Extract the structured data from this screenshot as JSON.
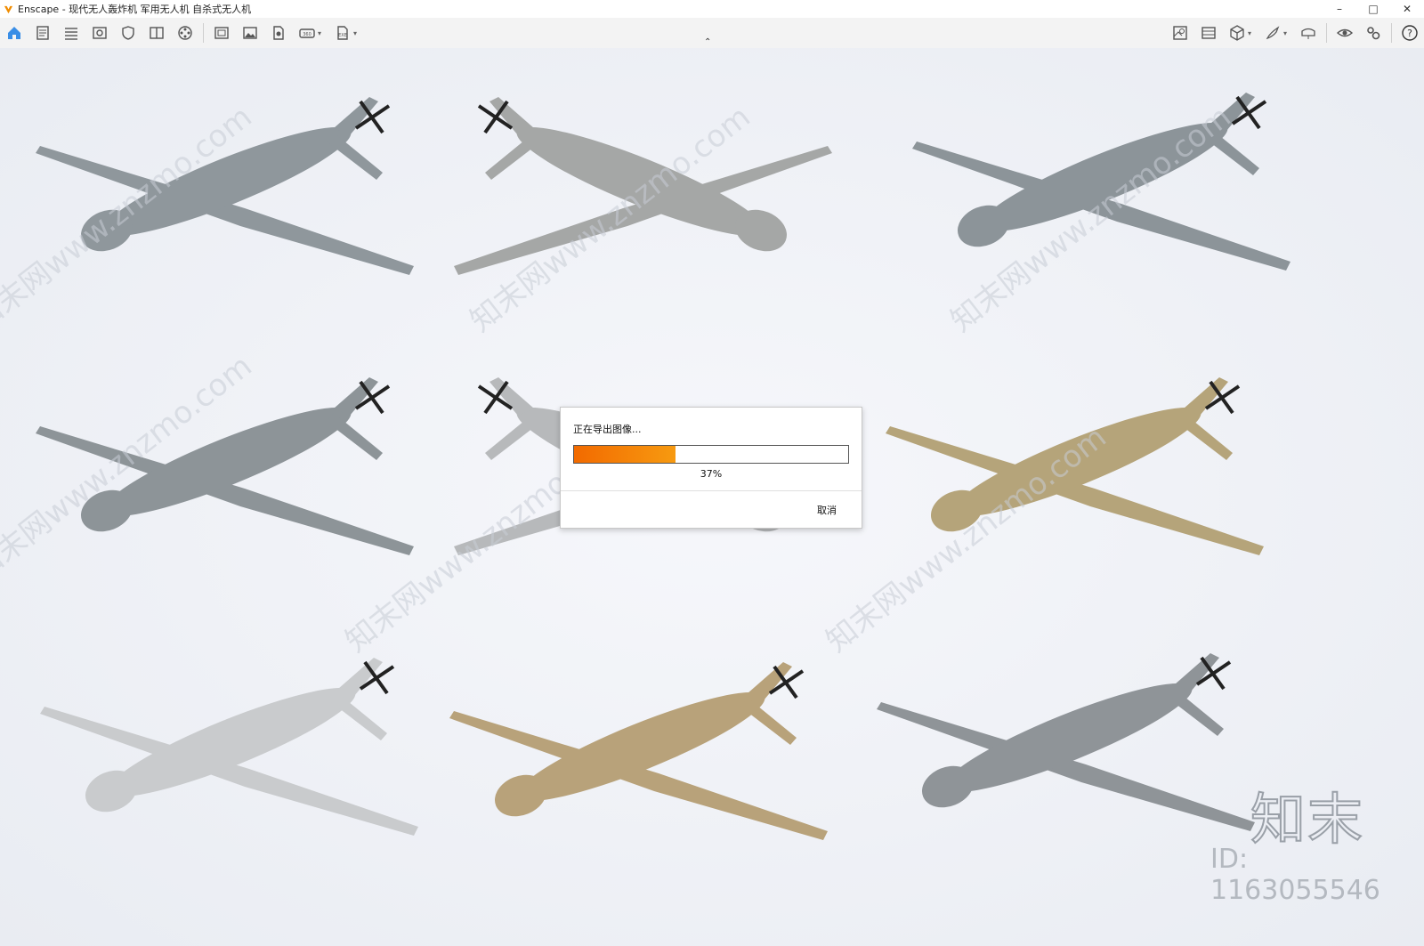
{
  "window": {
    "app_name": "Enscape",
    "title": "Enscape - 现代无人轰炸机 军用无人机 自杀式无人机",
    "controls": {
      "minimize": "–",
      "maximize": "□",
      "close": "✕"
    },
    "accent_color": "#f08c00"
  },
  "toolbar": {
    "left_icons": [
      "home-icon",
      "doc-icon",
      "bim-icon",
      "view-icon",
      "shield-icon",
      "book-icon",
      "film-icon",
      "frame-icon",
      "image-icon",
      "export-icon",
      "panorama-icon",
      "exe-icon"
    ],
    "right_icons": [
      "map-icon",
      "grid-icon",
      "cube-icon",
      "brush-icon",
      "vr-icon",
      "eye-icon",
      "settings-icon",
      "help-icon"
    ],
    "collapse_glyph": "⌃"
  },
  "viewport": {
    "watermark_text": "知末网www.znzmo.com",
    "brand_logo": "知末",
    "brand_id": "ID: 1163055546",
    "drone_colors": [
      "#8f979c",
      "#a5a7a6",
      "#8c9499",
      "#8d9498",
      "#b7b9bb",
      "#b5a47a",
      "#c9cbcd",
      "#b8a27a",
      "#8f9498"
    ]
  },
  "dialog": {
    "message": "正在导出图像...",
    "progress_percent": 37,
    "progress_label": "37%",
    "cancel_label": "取消"
  }
}
